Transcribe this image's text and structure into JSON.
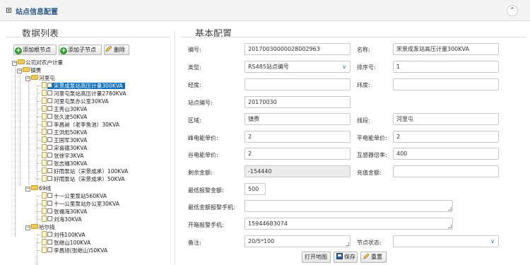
{
  "header": {
    "title": "站点信息配置",
    "collapse_glyph": "⌃"
  },
  "left": {
    "title": "数据列表",
    "toolbar": {
      "add_root": "添加根节点",
      "add_child": "添加子节点",
      "delete": "删除"
    },
    "tree": {
      "root": "公司对农户计量",
      "group1": "镇赉",
      "sub1": "河里屯",
      "sub1_items": [
        "宋景成泵站高压计量300KVA",
        "河里屯泵站高压计量2780KVA",
        "河里屯泵办公室30KVA",
        "王秀山30KVA",
        "张久波50KVA",
        "李昌昶（老李鱼池）30KVA",
        "王洪彪50KVA",
        "王国军30KVA",
        "宋喜德30KVA",
        "张徐宇3KVA",
        "张志福30KVA",
        "好雨泵站（宋景成承）100KVA",
        "好雨泵站（宋景成承）50KVA"
      ],
      "group2": "69线",
      "group2_items": [
        "十一公里泵站560KVA",
        "十一公里泵站办公室30KVA",
        "张福海30KVA",
        "刘海30KVA"
      ],
      "group3": "哈尔挠",
      "group3_items": [
        "刘伟100KVA",
        "张继山100KVA",
        "李昌旭(张继山)50KVA"
      ]
    }
  },
  "right": {
    "title": "基本配置",
    "fields": {
      "code_label": "编号:",
      "code_value": "20170030000028002963",
      "name_label": "名称:",
      "name_value": "宋景成泵站高压计量300KVA",
      "type_label": "类型:",
      "type_value": "RS485站点编号",
      "order_label": "排序号:",
      "order_value": "1",
      "lng_label": "经度:",
      "lng_value": "",
      "lat_label": "纬度:",
      "lat_value": "",
      "station_label": "站点编号:",
      "station_value": "20170030",
      "region_label": "区域:",
      "region_value": "镇赉",
      "line_label": "线段:",
      "line_value": "河里屯",
      "peak_label": "峰电能单价:",
      "peak_value": "2",
      "flat_label": "平电能单价:",
      "flat_value": "2",
      "valley_label": "谷电能单价:",
      "valley_value": "2",
      "ct_label": "互感器倍率:",
      "ct_value": "400",
      "balance_label": "剩余金额:",
      "balance_value": "-154440",
      "recharge_label": "充值金额:",
      "recharge_value": "",
      "min_alarm_label": "最低报警金额:",
      "min_alarm_value": "500",
      "min_phone_label": "最低金额报警手机:",
      "min_phone_value": "",
      "gate_phone_label": "开箱报警手机:",
      "gate_phone_value": "15944683074",
      "note_label": "备注:",
      "note_value": "20/5*100",
      "node_status_label": "节点状态:",
      "node_status_value": ""
    },
    "actions": {
      "open_map": "打开地图",
      "save": "保存",
      "reset": "重置"
    }
  },
  "colors": {
    "selected": "#0a6ebd",
    "header_title": "#2b5a8a",
    "add_icon": "#2e9b2e"
  }
}
